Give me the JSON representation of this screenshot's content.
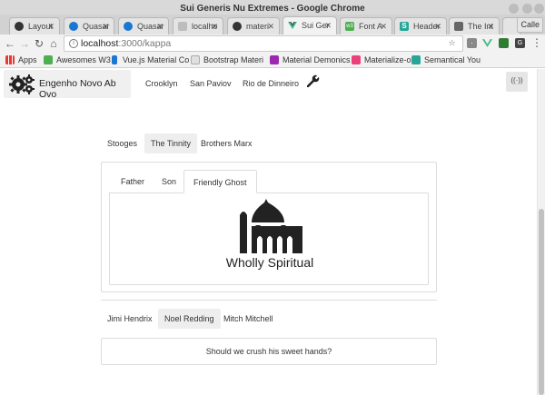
{
  "window": {
    "title": "Sui Generis Nu Extremes - Google Chrome",
    "user_button": "Calle"
  },
  "tabs": [
    {
      "label": "Layout",
      "icon": "github-icon",
      "color": "#333333",
      "active": false
    },
    {
      "label": "Quasar",
      "icon": "quasar-icon",
      "color": "#1976d2",
      "active": false
    },
    {
      "label": "Quasar",
      "icon": "quasar-icon",
      "color": "#1976d2",
      "active": false
    },
    {
      "label": "localho",
      "icon": "page-icon",
      "color": "#9e9e9e",
      "active": false
    },
    {
      "label": "materi",
      "icon": "github-icon",
      "color": "#333333",
      "active": false
    },
    {
      "label": "Sui Ger",
      "icon": "vue-icon",
      "color": "#41b883",
      "active": true
    },
    {
      "label": "Font A",
      "icon": "w3-icon",
      "color": "#4caf50",
      "active": false
    },
    {
      "label": "Header",
      "icon": "s-icon",
      "color": "#26a69a",
      "active": false
    },
    {
      "label": "The Int",
      "icon": "image-icon",
      "color": "#555555",
      "active": false
    }
  ],
  "address_bar": {
    "host": "localhost",
    "path": ":3000/kappa"
  },
  "bookmarks": [
    {
      "label": "Apps",
      "icon": "apps-grid-icon",
      "color": "#e53935"
    },
    {
      "label": "Awesomes W3",
      "icon": "w3-icon",
      "color": "#4caf50"
    },
    {
      "label": "Vue.js Material Co",
      "icon": "bookmark-flag-icon",
      "color": "#1976d2"
    },
    {
      "label": "Bootstrap Materi",
      "icon": "page-icon",
      "color": "#9e9e9e"
    },
    {
      "label": "Material Demonics",
      "icon": "materialize-icon",
      "color": "#9c27b0"
    },
    {
      "label": "Materialize-o",
      "icon": "materialize-icon",
      "color": "#ec407a"
    },
    {
      "label": "Semantical You",
      "icon": "s-icon",
      "color": "#26a69a"
    }
  ],
  "navbar": {
    "brand": "Engenho Novo Ab Ovo",
    "links": [
      "Crooklyn",
      "San Paviov",
      "Rio de Dinneiro"
    ]
  },
  "pills_top": {
    "items": [
      "Stooges",
      "The Tinnity",
      "Brothers Marx"
    ],
    "active_index": 1
  },
  "inner_tabs": {
    "items": [
      "Father",
      "Son",
      "Friendly Ghost"
    ],
    "active_index": 2
  },
  "pane": {
    "caption": "Wholly Spiritual"
  },
  "pills_bottom": {
    "items": [
      "Jimi Hendrix",
      "Noel Redding",
      "Mitch Mitchell"
    ],
    "active_index": 1
  },
  "question": "Should we crush his sweet hands?"
}
